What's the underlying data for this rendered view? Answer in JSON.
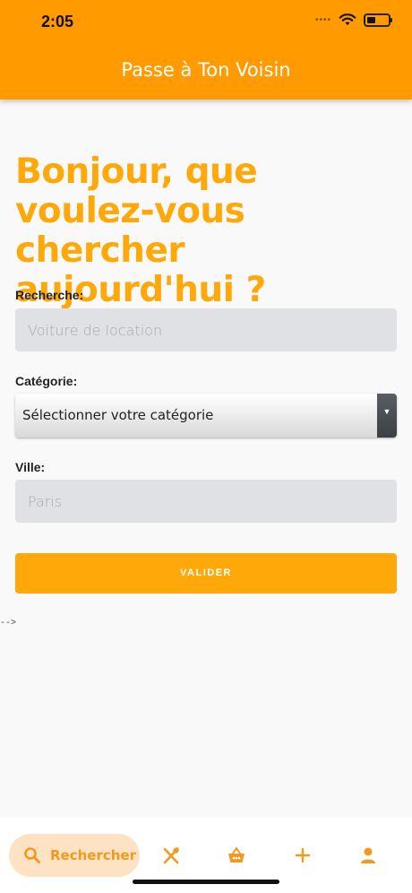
{
  "status_bar": {
    "time": "2:05",
    "signal": "••••"
  },
  "header": {
    "title": "Passe à Ton Voisin"
  },
  "colors": {
    "accent": "#ff9a00",
    "button": "#ffa80a",
    "tab_active_bg": "#fde2c3"
  },
  "main": {
    "heading": "Bonjour, que voulez-vous chercher aujourd'hui ?",
    "search": {
      "label": "Recherche:",
      "placeholder": "Voiture de location"
    },
    "category": {
      "label": "Catégorie:",
      "selected": "Sélectionner votre catégorie"
    },
    "city": {
      "label": "Ville:",
      "placeholder": "Paris"
    },
    "submit_label": "VALIDER",
    "stray_text": "-->"
  },
  "tabbar": {
    "active": {
      "label": "Rechercher",
      "icon": "search-icon"
    },
    "items": [
      {
        "icon": "utensils-icon"
      },
      {
        "icon": "basket-icon"
      },
      {
        "icon": "plus-icon"
      },
      {
        "icon": "user-icon"
      }
    ]
  }
}
